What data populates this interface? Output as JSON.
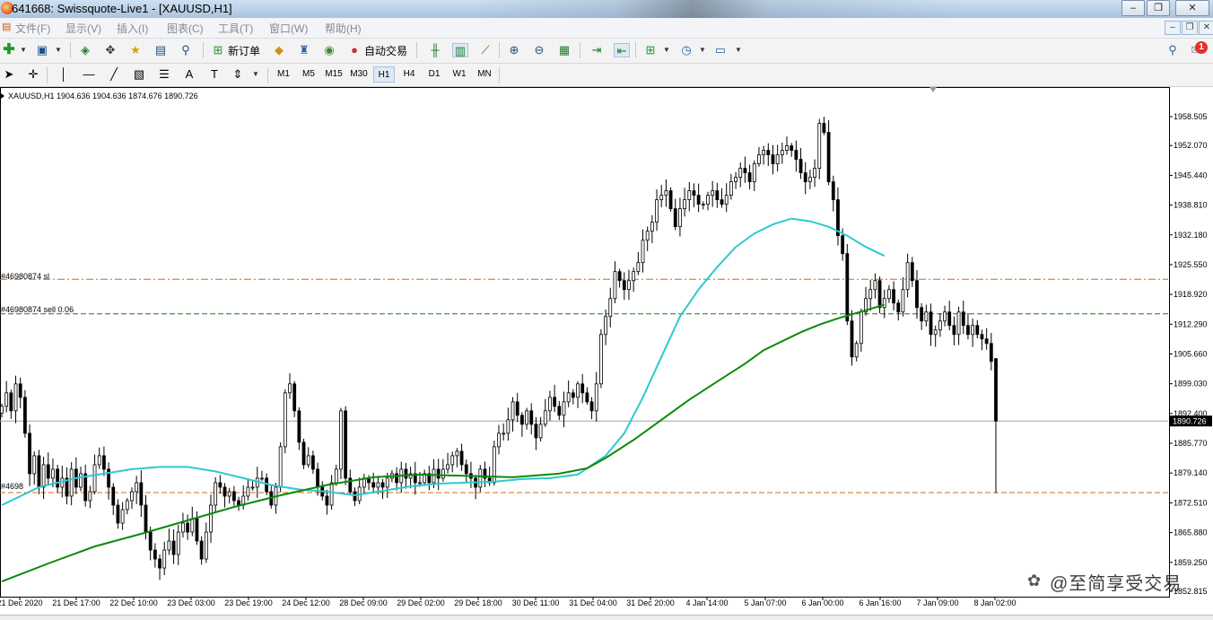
{
  "window": {
    "title": "641668: Swissquote-Live1 - [XAUUSD,H1]",
    "minimize": "‒",
    "restore": "❐",
    "close": "✕"
  },
  "menu": {
    "items": [
      "文件(F)",
      "显示(V)",
      "插入(I)",
      "图表(C)",
      "工具(T)",
      "窗口(W)",
      "帮助(H)"
    ]
  },
  "toolbar": {
    "new_order_label": "新订单",
    "auto_trade_label": "自动交易",
    "notification_count": "1"
  },
  "timeframes": {
    "items": [
      "M1",
      "M5",
      "M15",
      "M30",
      "H1",
      "H4",
      "D1",
      "W1",
      "MN"
    ],
    "active": "H1"
  },
  "chart_info": {
    "symbol_line": "XAUUSD,H1  1904.636 1904.636 1874.676 1890.726"
  },
  "orders": {
    "sl_label": "#46980874 sl",
    "sell_label": "#46980874 sell 0.06",
    "tp_label": "#4698",
    "sl_price": 1922.3,
    "entry_price": 1914.6,
    "tp_price": 1874.8
  },
  "colors": {
    "ma_fast": "#2ec9cf",
    "ma_slow": "#0b8a0b",
    "sl_line": "#d2691e",
    "entry_line": "#1a7f1a",
    "tp_line": "#d2691e",
    "bid_line": "#a0a0a0",
    "price_box": "#000000"
  },
  "watermark": "@至简享受交易",
  "chart_data": {
    "type": "candlestick",
    "symbol": "XAUUSD",
    "timeframe": "H1",
    "last_ohlc": [
      1904.636,
      1904.636,
      1874.676,
      1890.726
    ],
    "current_price": "1890.726",
    "y_ticks": [
      "1958.505",
      "1952.070",
      "1945.440",
      "1938.810",
      "1932.180",
      "1925.550",
      "1918.920",
      "1912.290",
      "1905.660",
      "1899.030",
      "1892.400",
      "1885.770",
      "1879.140",
      "1872.510",
      "1865.880",
      "1859.250",
      "1852.815"
    ],
    "ylim": [
      1852.815,
      1960.0
    ],
    "x_ticks": [
      "21 Dec 2020",
      "21 Dec 17:00",
      "22 Dec 10:00",
      "23 Dec 03:00",
      "23 Dec 19:00",
      "24 Dec 12:00",
      "28 Dec 09:00",
      "29 Dec 02:00",
      "29 Dec 18:00",
      "30 Dec 11:00",
      "31 Dec 04:00",
      "31 Dec 20:00",
      "4 Jan 14:00",
      "5 Jan 07:00",
      "6 Jan 00:00",
      "6 Jan 16:00",
      "7 Jan 09:00",
      "8 Jan 02:00"
    ],
    "closes": [
      1894,
      1897,
      1893,
      1899,
      1896,
      1888,
      1879,
      1883,
      1876,
      1881,
      1878,
      1880,
      1876,
      1878,
      1874,
      1880,
      1876,
      1879,
      1873,
      1875,
      1881,
      1883,
      1880,
      1876,
      1872,
      1868,
      1871,
      1873,
      1875,
      1877,
      1872,
      1866,
      1862,
      1860,
      1858,
      1862,
      1864,
      1861,
      1866,
      1868,
      1866,
      1869,
      1864,
      1860,
      1866,
      1872,
      1877,
      1876,
      1874,
      1875,
      1873,
      1872,
      1874,
      1876,
      1876,
      1878,
      1878,
      1875,
      1872,
      1876,
      1885,
      1897,
      1899,
      1893,
      1886,
      1881,
      1883,
      1880,
      1876,
      1874,
      1872,
      1877,
      1880,
      1893,
      1878,
      1875,
      1873,
      1876,
      1878,
      1877,
      1876,
      1877,
      1876,
      1878,
      1879,
      1877,
      1880,
      1878,
      1879,
      1877,
      1877,
      1879,
      1877,
      1880,
      1878,
      1880,
      1881,
      1883,
      1884,
      1881,
      1879,
      1878,
      1876,
      1880,
      1878,
      1877,
      1885,
      1888,
      1888,
      1891,
      1895,
      1892,
      1890,
      1893,
      1890,
      1887,
      1890,
      1893,
      1896,
      1894,
      1892,
      1895,
      1897,
      1896,
      1899,
      1897,
      1895,
      1893,
      1899,
      1910,
      1914,
      1918,
      1924,
      1922,
      1920,
      1922,
      1924,
      1926,
      1931,
      1933,
      1935,
      1940,
      1941,
      1942,
      1938,
      1934,
      1938,
      1940,
      1942,
      1941,
      1939,
      1939,
      1941,
      1942,
      1940,
      1939,
      1941,
      1944,
      1945,
      1947,
      1946,
      1944,
      1948,
      1950,
      1951,
      1950,
      1948,
      1950,
      1951,
      1952,
      1951,
      1949,
      1946,
      1944,
      1945,
      1947,
      1957,
      1955,
      1944,
      1940,
      1932,
      1928,
      1913,
      1905,
      1908,
      1915,
      1918,
      1920,
      1922,
      1916,
      1918,
      1920,
      1917,
      1915,
      1920,
      1926,
      1922,
      1916,
      1913,
      1915,
      1910,
      1911,
      1913,
      1915,
      1912,
      1910,
      1915,
      1912,
      1910,
      1912,
      1910,
      1909,
      1908,
      1904,
      1890.726
    ],
    "ma_fast_points": [
      {
        "x": 0,
        "y": 1872
      },
      {
        "x": 8,
        "y": 1876
      },
      {
        "x": 16,
        "y": 1878
      },
      {
        "x": 22,
        "y": 1879
      },
      {
        "x": 28,
        "y": 1880
      },
      {
        "x": 34,
        "y": 1880.5
      },
      {
        "x": 40,
        "y": 1880.5
      },
      {
        "x": 46,
        "y": 1879.5
      },
      {
        "x": 52,
        "y": 1878
      },
      {
        "x": 58,
        "y": 1876.5
      },
      {
        "x": 64,
        "y": 1875.5
      },
      {
        "x": 70,
        "y": 1875
      },
      {
        "x": 76,
        "y": 1874.2
      },
      {
        "x": 82,
        "y": 1875.2
      },
      {
        "x": 88,
        "y": 1876.2
      },
      {
        "x": 94,
        "y": 1876.8
      },
      {
        "x": 100,
        "y": 1877
      },
      {
        "x": 106,
        "y": 1877.2
      },
      {
        "x": 112,
        "y": 1877.8
      },
      {
        "x": 118,
        "y": 1878
      },
      {
        "x": 124,
        "y": 1878.8
      },
      {
        "x": 130,
        "y": 1883
      },
      {
        "x": 134,
        "y": 1888
      },
      {
        "x": 138,
        "y": 1896
      },
      {
        "x": 142,
        "y": 1905
      },
      {
        "x": 146,
        "y": 1914
      },
      {
        "x": 150,
        "y": 1920
      },
      {
        "x": 154,
        "y": 1925
      },
      {
        "x": 158,
        "y": 1929.5
      },
      {
        "x": 162,
        "y": 1932.5
      },
      {
        "x": 166,
        "y": 1934.5
      },
      {
        "x": 170,
        "y": 1935.8
      },
      {
        "x": 174,
        "y": 1935.2
      },
      {
        "x": 178,
        "y": 1934
      },
      {
        "x": 182,
        "y": 1932
      },
      {
        "x": 186,
        "y": 1929.5
      },
      {
        "x": 190,
        "y": 1927.5
      }
    ],
    "ma_slow_points": [
      {
        "x": 0,
        "y": 1855
      },
      {
        "x": 10,
        "y": 1859
      },
      {
        "x": 20,
        "y": 1862.8
      },
      {
        "x": 30,
        "y": 1865.6
      },
      {
        "x": 40,
        "y": 1868.6
      },
      {
        "x": 50,
        "y": 1871.6
      },
      {
        "x": 60,
        "y": 1874.2
      },
      {
        "x": 70,
        "y": 1876.5
      },
      {
        "x": 80,
        "y": 1878.2
      },
      {
        "x": 90,
        "y": 1878.8
      },
      {
        "x": 100,
        "y": 1878.5
      },
      {
        "x": 110,
        "y": 1878.2
      },
      {
        "x": 120,
        "y": 1879
      },
      {
        "x": 126,
        "y": 1880.2
      },
      {
        "x": 130,
        "y": 1882.5
      },
      {
        "x": 136,
        "y": 1886.5
      },
      {
        "x": 142,
        "y": 1891
      },
      {
        "x": 148,
        "y": 1895.5
      },
      {
        "x": 154,
        "y": 1899.5
      },
      {
        "x": 160,
        "y": 1903.5
      },
      {
        "x": 164,
        "y": 1906.5
      },
      {
        "x": 168,
        "y": 1908.5
      },
      {
        "x": 172,
        "y": 1910.5
      },
      {
        "x": 176,
        "y": 1912.2
      },
      {
        "x": 180,
        "y": 1913.6
      },
      {
        "x": 184,
        "y": 1914.8
      },
      {
        "x": 190,
        "y": 1916.6
      }
    ]
  }
}
